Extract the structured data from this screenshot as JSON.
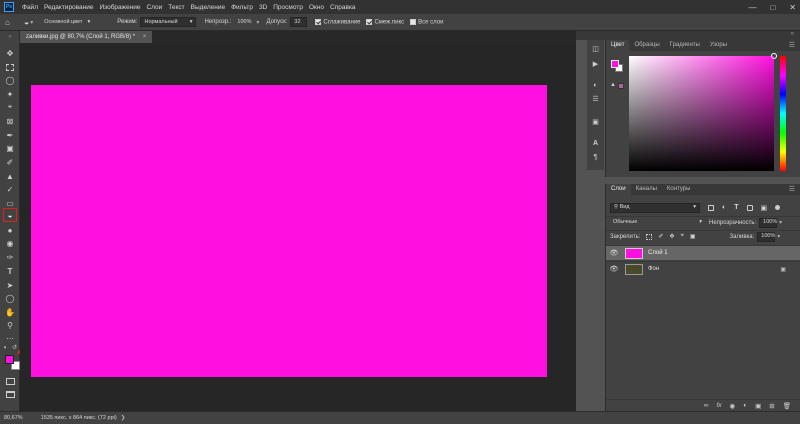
{
  "app_logo": "Ps",
  "menu": [
    "Файл",
    "Редактирование",
    "Изображение",
    "Слои",
    "Текст",
    "Выделение",
    "Фильтр",
    "3D",
    "Просмотр",
    "Окно",
    "Справка"
  ],
  "options": {
    "source": "Основной цвет",
    "mode_label": "Режим:",
    "mode_value": "Нормальный",
    "opacity_label": "Непрозр.:",
    "opacity_value": "100%",
    "tolerance_label": "Допуск:",
    "tolerance_value": "32",
    "antialias": "Сглаживание",
    "contiguous": "Смеж.пикс",
    "all_layers": "Все слои"
  },
  "document": {
    "tab_title": "zаливки.jpg @ 80,7% (Слой 1, RGB/8) *"
  },
  "colors": {
    "foreground": "#ff10e0",
    "background": "#ffffff",
    "canvas": "#ff10e0"
  },
  "color_panel": {
    "tabs": [
      "Цвет",
      "Образцы",
      "Градиенты",
      "Узоры"
    ]
  },
  "layers_panel": {
    "tabs": [
      "Слои",
      "Каналы",
      "Контуры"
    ],
    "search": "Вид",
    "blend_mode": "Обычные",
    "opacity_label": "Непрозрачность:",
    "opacity_value": "100%",
    "lock_label": "Закрепить:",
    "fill_label": "Заливка:",
    "fill_value": "100%",
    "layers": [
      {
        "name": "Слой 1",
        "selected": true
      },
      {
        "name": "Фон",
        "selected": false
      }
    ]
  },
  "status": {
    "zoom": "80,67%",
    "info": "1535 пикс. x 864 пикс. (72 ppi)"
  }
}
